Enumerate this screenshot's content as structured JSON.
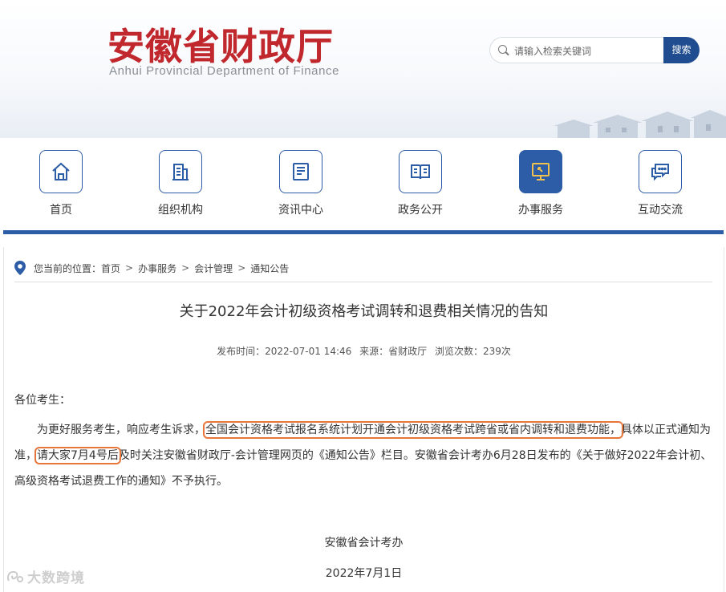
{
  "header": {
    "title": "安徽省财政厅",
    "subtitle": "Anhui Provincial Department of Finance",
    "search_placeholder": "请输入检索关键词",
    "search_button": "搜索"
  },
  "nav": {
    "items": [
      {
        "label": "首页",
        "icon": "home-icon"
      },
      {
        "label": "组织机构",
        "icon": "building-icon"
      },
      {
        "label": "资讯中心",
        "icon": "news-icon"
      },
      {
        "label": "政务公开",
        "icon": "book-icon"
      },
      {
        "label": "办事服务",
        "icon": "monitor-icon",
        "active": true
      },
      {
        "label": "互动交流",
        "icon": "chat-icon"
      }
    ],
    "accent_color": "#2d5da6"
  },
  "breadcrumb": {
    "prefix": "您当前的位置：",
    "items": [
      "首页",
      "办事服务",
      "会计管理",
      "通知公告"
    ],
    "separator": ">"
  },
  "article": {
    "title": "关于2022年会计初级资格考试调转和退费相关情况的告知",
    "publish_label": "发布时间：",
    "publish_time": "2022-07-01 14:46",
    "source_label": "来源：",
    "source": "省财政厅",
    "views_label": "浏览次数：",
    "views": "239次",
    "greeting": "各位考生：",
    "para_part1": "为更好服务考生，响应考生诉求，",
    "para_highlight1": "全国会计资格考试报名系统计划开通会计初级资格考试跨省或省内调转和退费功能，",
    "para_part2": "具体以正式通知为准，",
    "para_highlight2": "请大家7月4号后",
    "para_part3": "及时关注安徽省财政厅-会计管理网页的《通知公告》栏目。安徽省会计考办6月28日发布的《关于做好2022年会计初、高级资格考试退费工作的通知》不予执行。",
    "signature": "安徽省会计考办",
    "date": "2022年7月1日",
    "highlight_color": "#e7763a"
  },
  "watermark": "大数跨境"
}
